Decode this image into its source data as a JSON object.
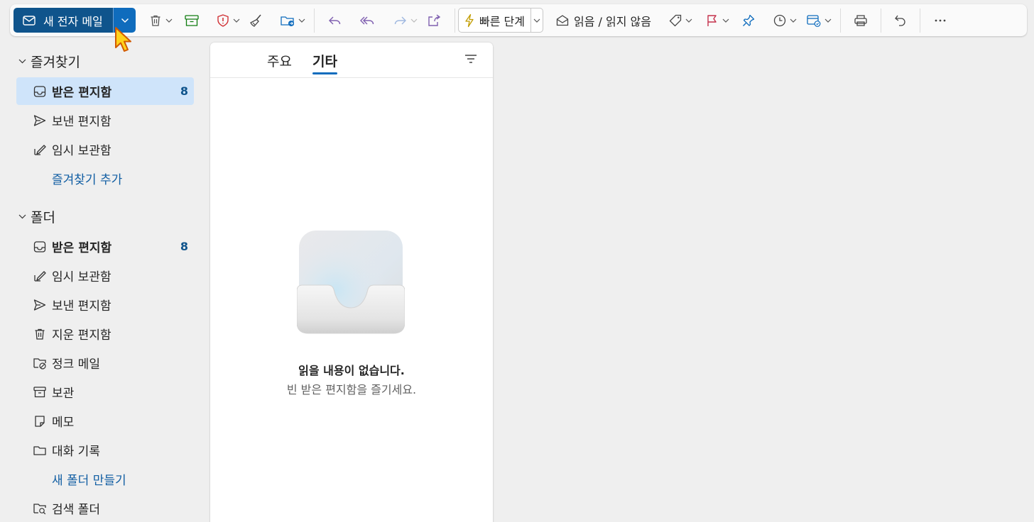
{
  "toolbar": {
    "new_mail_label": "새 전자 메일",
    "quick_steps_label": "빠른 단계",
    "read_unread_label": "읽음 / 읽지 않음"
  },
  "sidebar": {
    "favorites": {
      "title": "즐겨찾기",
      "items": [
        {
          "label": "받은 편지함",
          "count": "8",
          "icon": "inbox-icon"
        },
        {
          "label": "보낸 편지함",
          "icon": "send-icon"
        },
        {
          "label": "임시 보관함",
          "icon": "draft-icon"
        }
      ],
      "add_link": "즐겨찾기 추가"
    },
    "folders": {
      "title": "폴더",
      "items": [
        {
          "label": "받은 편지함",
          "count": "8",
          "icon": "inbox-icon"
        },
        {
          "label": "임시 보관함",
          "icon": "draft-icon"
        },
        {
          "label": "보낸 편지함",
          "icon": "send-icon"
        },
        {
          "label": "지운 편지함",
          "icon": "trash-icon"
        },
        {
          "label": "정크 메일",
          "icon": "junk-icon"
        },
        {
          "label": "보관",
          "icon": "archive-icon"
        },
        {
          "label": "메모",
          "icon": "note-icon"
        },
        {
          "label": "대화 기록",
          "icon": "folder-icon"
        }
      ],
      "new_folder_link": "새 폴더 만들기",
      "search_folder": {
        "label": "검색 폴더",
        "icon": "search-folder-icon"
      }
    }
  },
  "list": {
    "tabs": [
      "주요",
      "기타"
    ],
    "active_tab": "기타",
    "empty_title": "읽을 내용이 없습니다.",
    "empty_subtitle": "빈 받은 편지함을 즐기세요."
  },
  "colors": {
    "accent": "#0f6cbd",
    "accent_dark": "#0f548c",
    "selected_bg": "#cfe4fa",
    "flag": "#c4314b",
    "archive": "#107c10",
    "report": "#d13438",
    "move": "#0f6cbd"
  }
}
